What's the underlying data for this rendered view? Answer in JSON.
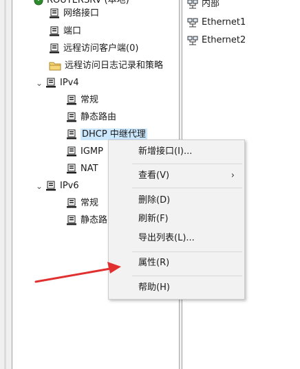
{
  "tree": {
    "root_label": "ROUTERSRV (本地)",
    "items": [
      {
        "label": "网络接口"
      },
      {
        "label": "端口"
      },
      {
        "label": "远程访问客户端(0)"
      },
      {
        "label": "远程访问日志记录和策略"
      },
      {
        "label": "IPv4"
      },
      {
        "label": "常规"
      },
      {
        "label": "静态路由"
      },
      {
        "label": "DHCP 中继代理"
      },
      {
        "label": "IGMP"
      },
      {
        "label": "NAT"
      },
      {
        "label": "IPv6"
      },
      {
        "label": "常规"
      },
      {
        "label": "静态路由"
      }
    ]
  },
  "list": {
    "items": [
      {
        "label": "内部"
      },
      {
        "label": "Ethernet1"
      },
      {
        "label": "Ethernet2"
      }
    ]
  },
  "context_menu": {
    "items": [
      {
        "label": "新增接口(I)..."
      },
      {
        "label": "查看(V)",
        "submenu_glyph": "›"
      },
      {
        "label": "删除(D)"
      },
      {
        "label": "刷新(F)"
      },
      {
        "label": "导出列表(L)..."
      },
      {
        "label": "属性(R)"
      },
      {
        "label": "帮助(H)"
      }
    ]
  },
  "colors": {
    "selection": "#cce8ff",
    "menu_bg": "#f2f2f2",
    "annotation_arrow": "#e03030"
  },
  "icons": {
    "server": "server-icon",
    "folder": "folder-icon",
    "network": "network-interface-icon",
    "power": "power-icon",
    "expand": "chevron-down-icon",
    "submenu": "chevron-right-icon"
  }
}
